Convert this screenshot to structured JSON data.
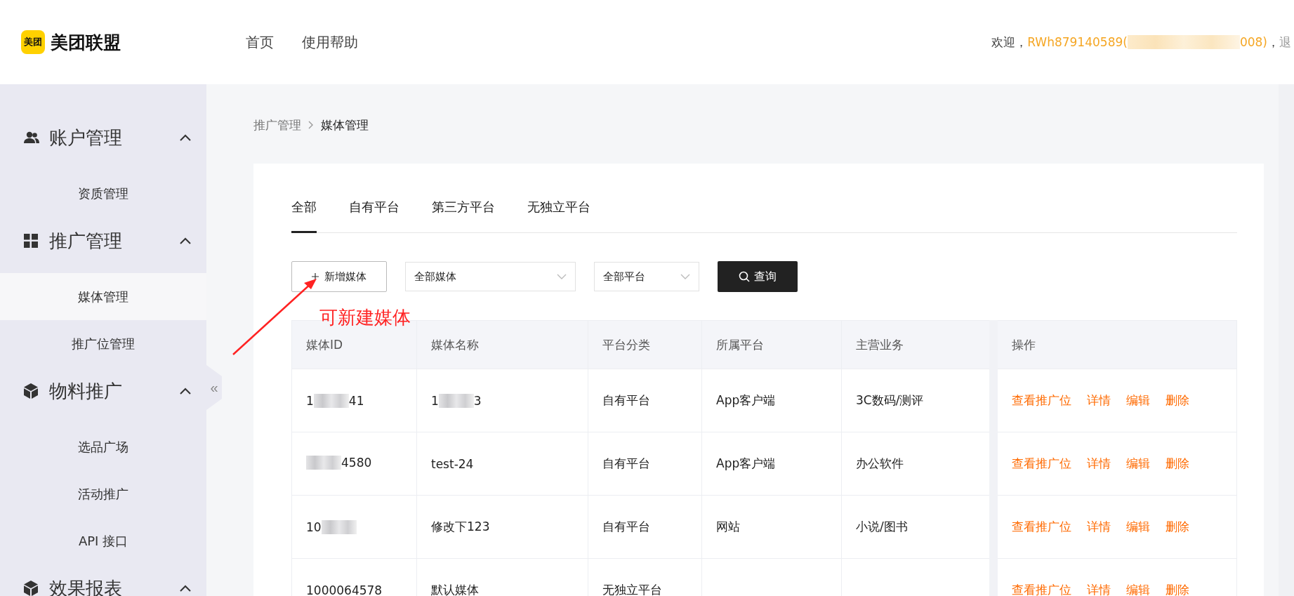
{
  "header": {
    "logo_badge": "美团",
    "logo_text": "美团联盟",
    "nav": [
      {
        "label": "首页"
      },
      {
        "label": "使用帮助"
      }
    ],
    "welcome": "欢迎，",
    "user": {
      "before": "RWh879140589(",
      "after": "008)",
      "redacted": true
    },
    "separator": "，",
    "logout": "退"
  },
  "sidebar": {
    "groups": [
      {
        "label": "账户管理",
        "expanded": true,
        "items": [
          {
            "label": "资质管理",
            "selected": false
          }
        ]
      },
      {
        "label": "推广管理",
        "expanded": true,
        "items": [
          {
            "label": "媒体管理",
            "selected": true
          },
          {
            "label": "推广位管理",
            "selected": false
          }
        ]
      },
      {
        "label": "物料推广",
        "expanded": true,
        "items": [
          {
            "label": "选品广场",
            "selected": false
          },
          {
            "label": "活动推广",
            "selected": false
          },
          {
            "label": "API 接口",
            "selected": false
          }
        ]
      },
      {
        "label": "效果报表",
        "expanded": true
      }
    ],
    "collapse": "«"
  },
  "breadcrumb": [
    {
      "label": "推广管理",
      "current": false
    },
    {
      "label": "媒体管理",
      "current": true
    }
  ],
  "tabs": [
    {
      "label": "全部",
      "selected": true
    },
    {
      "label": "自有平台",
      "selected": false
    },
    {
      "label": "第三方平台",
      "selected": false
    },
    {
      "label": "无独立平台",
      "selected": false
    }
  ],
  "toolbar": {
    "add_button": "新增媒体",
    "filters": [
      {
        "value": "全部媒体"
      },
      {
        "value": "全部平台"
      }
    ],
    "search_button": "查询"
  },
  "annotation": {
    "text": "可新建媒体"
  },
  "table": {
    "columns": [
      "媒体ID",
      "媒体名称",
      "平台分类",
      "所属平台",
      "主营业务",
      "操作"
    ],
    "rows": [
      {
        "id": {
          "before": "1",
          "after": "41",
          "redacted": true
        },
        "name": {
          "before": "1",
          "after": "3",
          "redacted": true
        },
        "category": "自有平台",
        "platform": "App客户端",
        "business": "3C数码/测评",
        "actions": [
          "查看推广位",
          "详情",
          "编辑",
          "删除"
        ]
      },
      {
        "id": {
          "after": "4580",
          "redacted": true
        },
        "name": {
          "before": "test-24",
          "redacted": false
        },
        "category": "自有平台",
        "platform": "App客户端",
        "business": "办公软件",
        "actions": [
          "查看推广位",
          "详情",
          "编辑",
          "删除"
        ]
      },
      {
        "id": {
          "before": "10",
          "redacted": true
        },
        "name": {
          "before": "修改下123",
          "redacted": false
        },
        "category": "自有平台",
        "platform": "网站",
        "business": "小说/图书",
        "actions": [
          "查看推广位",
          "详情",
          "编辑",
          "删除"
        ]
      },
      {
        "id": {
          "before": "1000064578",
          "redacted": false
        },
        "name": {
          "before": "默认媒体",
          "redacted": false
        },
        "category": "无独立平台",
        "actions": [
          "查看推广位",
          "详情",
          "编辑",
          "删除"
        ]
      }
    ]
  }
}
